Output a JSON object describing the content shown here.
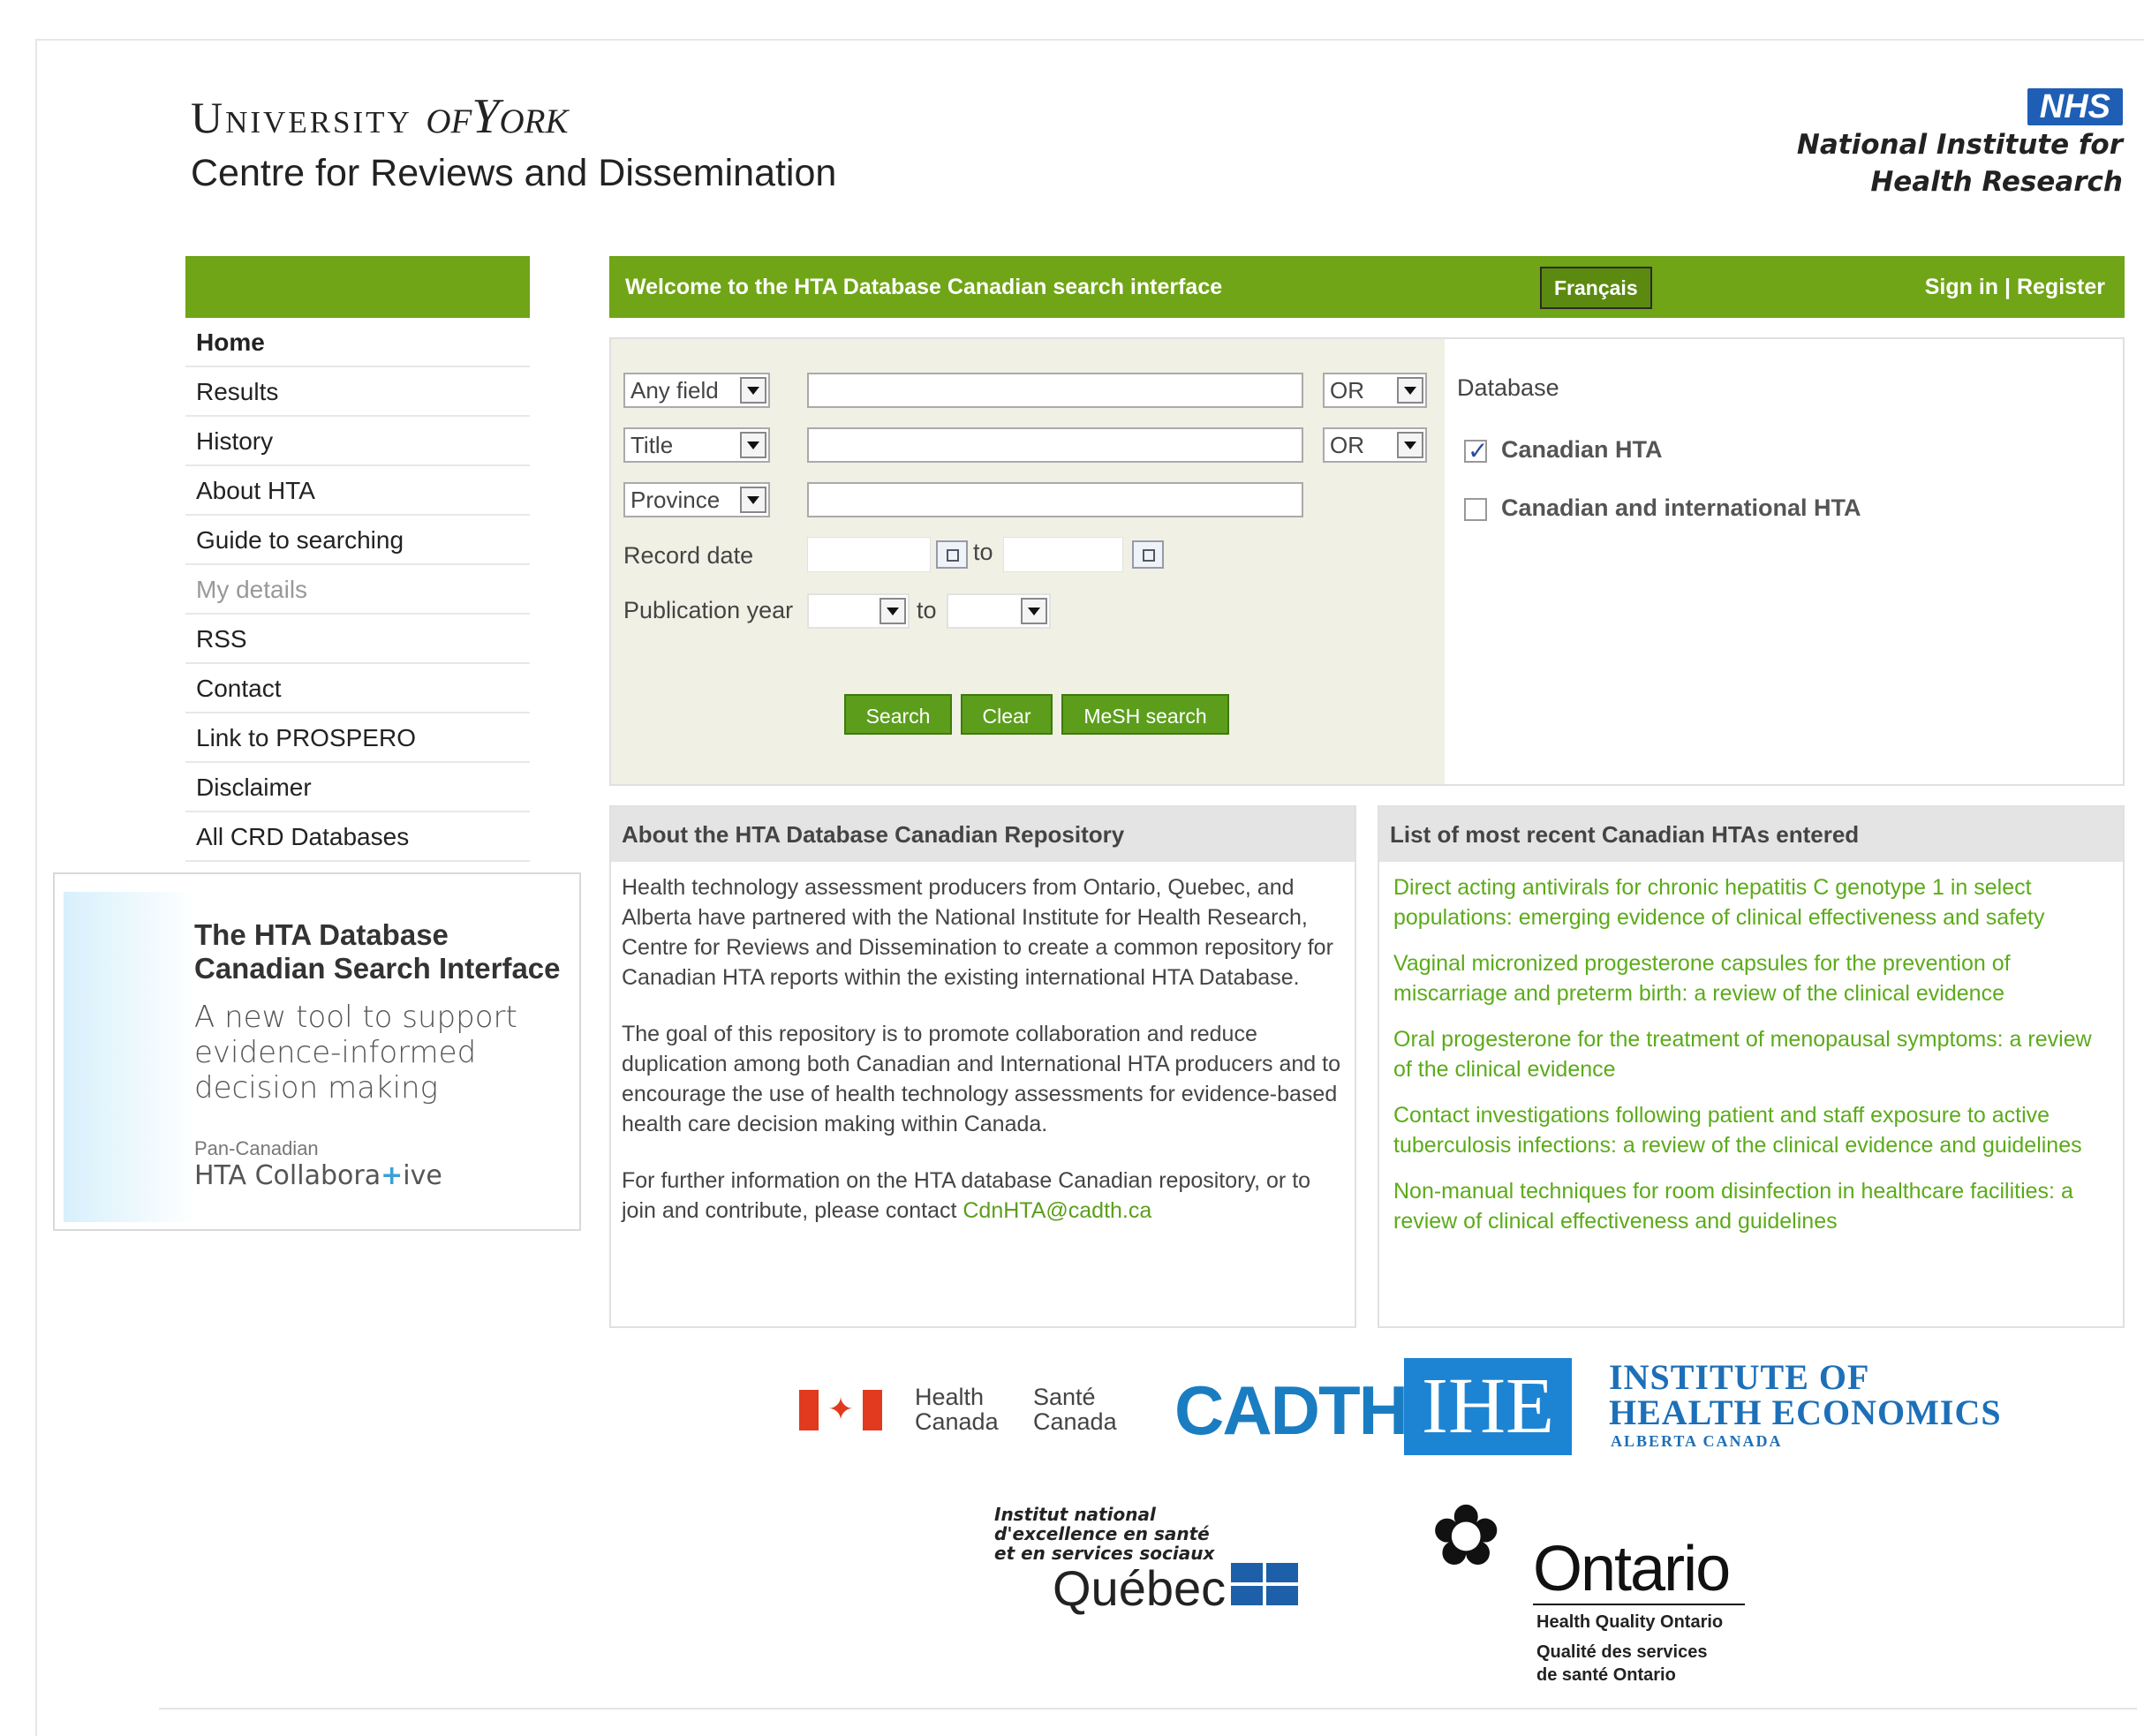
{
  "header": {
    "university_main": "University",
    "university_of": "of",
    "university_york": "York",
    "centre": "Centre for Reviews and Dissemination",
    "nhs": "NHS",
    "nihr_line1": "National Institute for",
    "nihr_line2": "Health Research"
  },
  "sidebar": {
    "items": [
      {
        "label": "Home"
      },
      {
        "label": "Results"
      },
      {
        "label": "History"
      },
      {
        "label": "About HTA"
      },
      {
        "label": "Guide to searching"
      },
      {
        "label": "My details"
      },
      {
        "label": "RSS"
      },
      {
        "label": "Contact"
      },
      {
        "label": "Link to PROSPERO"
      },
      {
        "label": "Disclaimer"
      },
      {
        "label": "All CRD Databases"
      }
    ],
    "promo": {
      "title_line1": "The HTA Database",
      "title_line2": "Canadian Search Interface",
      "text_line1": "A new tool to support",
      "text_line2": "evidence-informed",
      "text_line3": "decision making",
      "collab_small": "Pan-Canadian",
      "collab_a": "HTA Collabora",
      "collab_plus": "+",
      "collab_b": "ive"
    }
  },
  "topbar": {
    "welcome": "Welcome to the HTA Database Canadian search interface",
    "francais": "Français",
    "signin": "Sign in | Register"
  },
  "search": {
    "row1_field": "Any field",
    "row1_op": "OR",
    "row2_field": "Title",
    "row2_op": "OR",
    "row3_field": "Province",
    "record_date_label": "Record date",
    "to1": "to",
    "pubyear_label": "Publication year",
    "to2": "to",
    "search_btn": "Search",
    "clear_btn": "Clear",
    "mesh_btn": "MeSH search",
    "database_title": "Database",
    "db_options": [
      {
        "label": "Canadian HTA",
        "checked": true
      },
      {
        "label": "Canadian and international HTA",
        "checked": false
      }
    ]
  },
  "about": {
    "heading": "About the HTA Database Canadian Repository",
    "p1": "Health technology assessment producers from Ontario, Quebec, and Alberta have partnered with the National Institute for Health Research, Centre for Reviews and Dissemination to create a common repository for Canadian HTA reports within the existing international HTA Database.",
    "p2": "The goal of this repository is to promote collaboration and reduce duplication among both Canadian and International HTA producers and to encourage the use of health technology assessments for evidence-based health care decision making within Canada.",
    "p3_text": "For further information on the HTA database Canadian repository, or to join and contribute, please contact ",
    "p3_email": "CdnHTA@cadth.ca"
  },
  "recent": {
    "heading": "List of most recent Canadian HTAs entered",
    "items": [
      "Direct acting antivirals for chronic hepatitis C genotype 1 in select populations: emerging evidence of clinical effectiveness and safety",
      "Vaginal micronized progesterone capsules for the prevention of miscarriage and preterm birth: a review of the clinical evidence",
      "Oral progesterone for the treatment of menopausal symptoms: a review of the clinical evidence",
      "Contact investigations following patient and staff exposure to active tuberculosis infections: a review of the clinical evidence and guidelines",
      "Non-manual techniques for room disinfection in healthcare facilities: a review of clinical effectiveness and guidelines"
    ]
  },
  "logos": {
    "health_en_1": "Health",
    "health_en_2": "Canada",
    "health_fr_1": "Santé",
    "health_fr_2": "Canada",
    "cadth": "CADTH",
    "ihe_abbr": "IHE",
    "ihe_line1": "INSTITUTE OF",
    "ihe_line2": "HEALTH ECONOMICS",
    "ihe_sub": "ALBERTA CANADA",
    "inesss_line1": "Institut national",
    "inesss_line2": "d'excellence en santé",
    "inesss_line3": "et en services sociaux",
    "quebec": "Québec",
    "ontario": "Ontario",
    "hqo_en": "Health Quality Ontario",
    "hqo_fr1": "Qualité des services",
    "hqo_fr2": "de santé Ontario"
  }
}
